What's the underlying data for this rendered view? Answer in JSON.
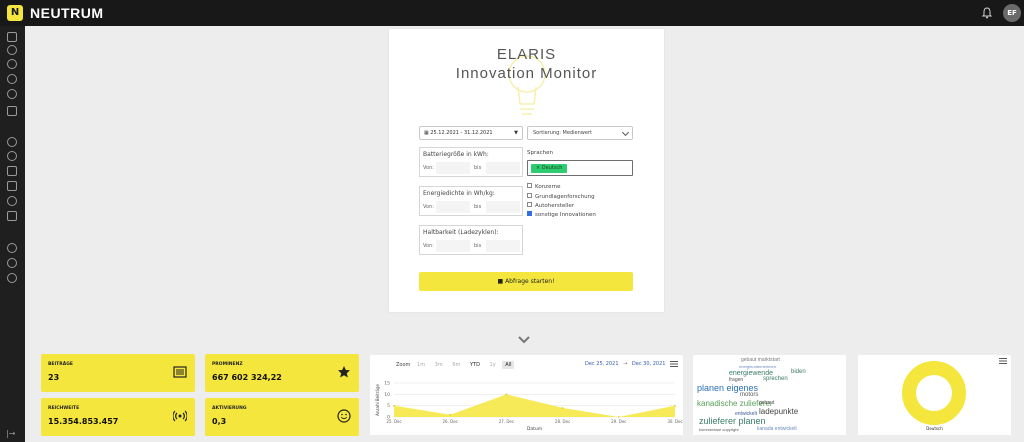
{
  "app": {
    "brand": "NEUTRUM",
    "user_initials": "EF",
    "logo_letter": "N"
  },
  "monitor": {
    "title_line1": "ELARIS",
    "title_line2": "Innovation Monitor",
    "date_range": "25.12.2021 - 31.12.2021",
    "sort_value": "Sortierung: Medienwert",
    "filters": [
      {
        "legend": "Batteriegröße in kWh:",
        "from_label": "Von:",
        "to_label": "bis"
      },
      {
        "legend": "Energiedichte in Wh/kg:",
        "from_label": "Von:",
        "to_label": "bis"
      },
      {
        "legend": "Haltbarkeit (Ladezyklen):",
        "from_label": "Von:",
        "to_label": "bis"
      }
    ],
    "languages_label": "Sprachen",
    "language_chip": "Deutsch",
    "checkboxes": [
      {
        "label": "Konzerne",
        "checked": false
      },
      {
        "label": "Grundlagenforschung",
        "checked": false
      },
      {
        "label": "Autohersteller",
        "checked": false
      },
      {
        "label": "sonstige Innovationen",
        "checked": true
      }
    ],
    "start_button": "Abfrage starten!"
  },
  "kpis": [
    {
      "label": "BEITRÄGE",
      "value": "23",
      "icon": "newspaper-icon"
    },
    {
      "label": "PROMINENZ",
      "value": "667 602 324,22",
      "icon": "star-icon"
    },
    {
      "label": "REICHWEITE",
      "value": "15.354.853.457",
      "icon": "broadcast-icon"
    },
    {
      "label": "AKTIVIERUNG",
      "value": "0,3",
      "icon": "smiley-icon"
    }
  ],
  "chart_panel": {
    "zoom_label": "Zoom",
    "zoom_buttons": [
      "1m",
      "3m",
      "6m",
      "YTD",
      "1y",
      "All"
    ],
    "range_from": "Dec 25, 2021",
    "range_dash": "→",
    "range_to": "Dec 30, 2021"
  },
  "chart_data": {
    "type": "area",
    "x": [
      "25. Dec",
      "26. Dec",
      "27. Dec",
      "28. Dec",
      "29. Dec",
      "30. Dec"
    ],
    "values": [
      5,
      1,
      10,
      4,
      0,
      5
    ],
    "ylabel": "Anzahl Beiträge",
    "xlabel": "Datum",
    "yticks": [
      0,
      5,
      10,
      15
    ],
    "ylim": [
      0,
      15
    ],
    "color": "#f4e63c",
    "grid": true
  },
  "word_cloud": [
    {
      "text": "gebaut marktstart",
      "color": "#7a7a7a"
    },
    {
      "text": "energieunternehmen",
      "color": "#6a8bbf"
    },
    {
      "text": "energiewende",
      "color": "#3a7d6a"
    },
    {
      "text": "biden",
      "color": "#3a7d6a"
    },
    {
      "text": "fragen",
      "color": "#555"
    },
    {
      "text": "sprechen",
      "color": "#3a7d6a"
    },
    {
      "text": "planen eigenes",
      "color": "#2a6fb5"
    },
    {
      "text": "motors",
      "color": "#555"
    },
    {
      "text": "kanadische zulieferer",
      "color": "#5aa05a"
    },
    {
      "text": "gebaut",
      "color": "#555"
    },
    {
      "text": "ladepunkte",
      "color": "#444"
    },
    {
      "text": "entwickelt",
      "color": "#3a5a9a"
    },
    {
      "text": "zulieferer planen",
      "color": "#3a7d6a"
    },
    {
      "text": "kommentare copyright",
      "color": "#555"
    },
    {
      "text": "kanada entwickelt",
      "color": "#6a8bbf"
    }
  ],
  "donut": {
    "label": "Deutsch",
    "color": "#f4e63c"
  }
}
